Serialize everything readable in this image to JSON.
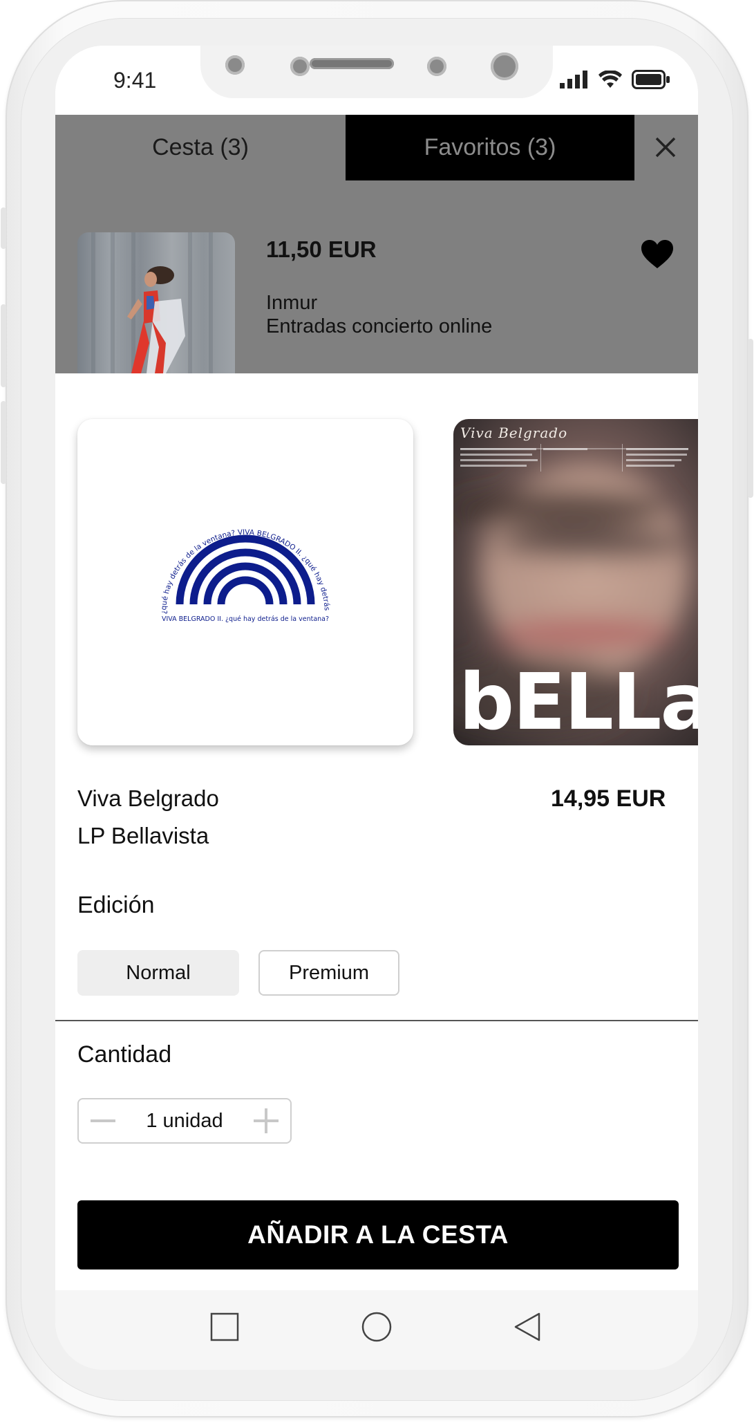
{
  "status_bar": {
    "time": "9:41"
  },
  "tabs": [
    {
      "label": "Cesta (3)"
    },
    {
      "label": "Favoritos (3)"
    }
  ],
  "cart_item": {
    "price": "11,50 EUR",
    "artist": "Inmur",
    "description": "Entradas concierto online"
  },
  "product": {
    "logo_text_top": "¿qué hay detrás de la ventana? VIVA BELGRADO II. ¿qué hay detrás de la ventana?",
    "logo_text_bottom": "VIVA BELGRADO II. ¿qué hay detrás de la ventana?",
    "cover_header": "Viva Belgrado",
    "cover_title": "bELLaVis",
    "artist": "Viva Belgrado",
    "title": "LP Bellavista",
    "price": "14,95 EUR"
  },
  "edition": {
    "label": "Edición",
    "options": [
      "Normal",
      "Premium"
    ],
    "selected": "Normal"
  },
  "quantity": {
    "label": "Cantidad",
    "value_text": "1 unidad"
  },
  "add_to_cart_label": "AÑADIR A LA CESTA",
  "colors": {
    "accent": "#000000",
    "dim_overlay": "#808080",
    "logo_blue": "#0d1d8c",
    "selected_option_bg": "#eeeeee"
  },
  "icons": {
    "close": "close-icon",
    "favorite": "heart-icon",
    "minus": "minus-icon",
    "plus": "plus-icon",
    "nav_recent": "square-icon",
    "nav_home": "circle-icon",
    "nav_back": "triangle-back-icon"
  }
}
